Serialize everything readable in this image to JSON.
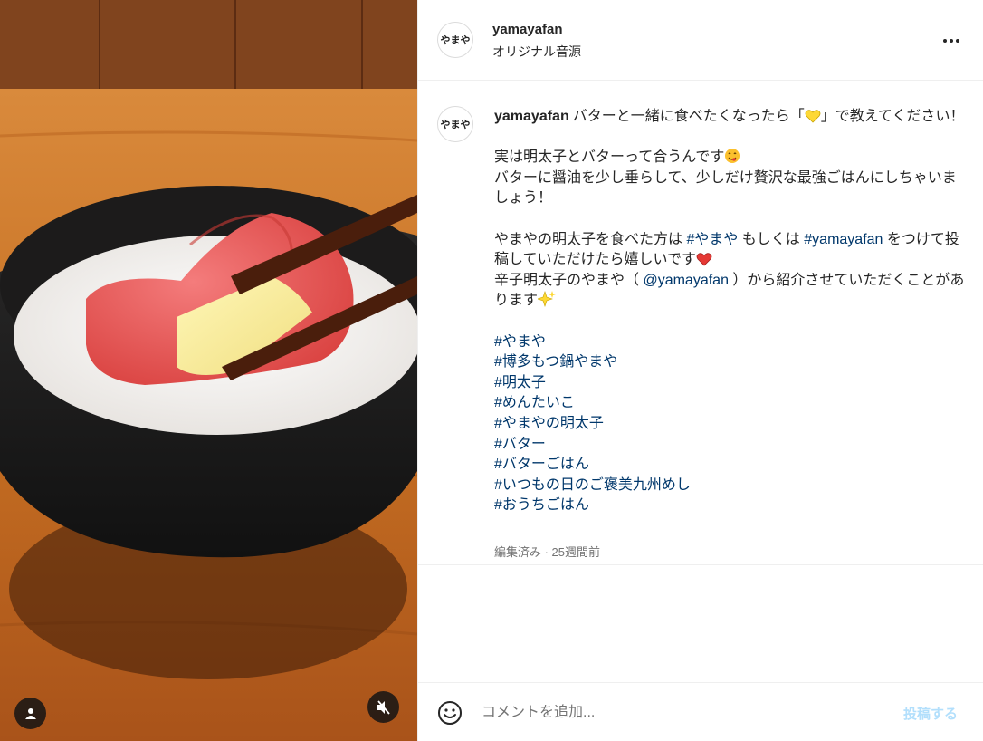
{
  "post": {
    "username": "yamayafan",
    "avatar_text": "やまや",
    "audio": "オリジナル音源",
    "more_icon": "more-horizontal-icon"
  },
  "caption": {
    "username": "yamayafan",
    "line1a": "バターと一緒に食べたくなったら「",
    "line1b": "」で教えてください！",
    "line2": "実は明太子とバターって合うんです",
    "line3": "バターに醤油を少し垂らして、少しだけ贅沢な最強ごはんにしちゃいましょう！",
    "line4a": "やまやの明太子を食べた方は ",
    "tag_inline1": "#やまや",
    "line4b": " もしくは ",
    "tag_inline2": "#yamayafan",
    "line4c": " をつけて投稿していただけたら嬉しいです",
    "line5a": "辛子明太子のやまや（ ",
    "mention": "@yamayafan",
    "line5b": " ）から紹介させていただくことがあります",
    "hashtags": [
      "#やまや",
      "#博多もつ鍋やまや",
      "#明太子",
      "#めんたいこ",
      "#やまやの明太子",
      "#バター",
      "#バターごはん",
      "#いつもの日のご褒美九州めし",
      "#おうちごはん"
    ],
    "meta": "編集済み · 25週間前",
    "emojis": [
      "yellow-heart-icon",
      "yum-face-icon",
      "red-heart-icon",
      "sparkles-icon"
    ]
  },
  "comment": {
    "placeholder": "コメントを追加...",
    "post_label": "投稿する"
  },
  "media": {
    "tag_icon": "user-tag-icon",
    "mute_icon": "speaker-muted-icon"
  },
  "colors": {
    "link": "#00376b",
    "post_disabled": "#b2dffc",
    "secondary_text": "#737373",
    "divider": "#efefef"
  }
}
